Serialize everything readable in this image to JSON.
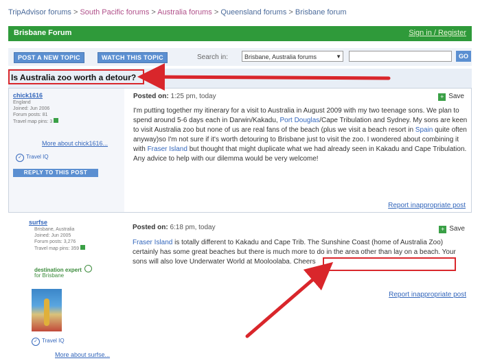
{
  "breadcrumb": [
    {
      "label": "TripAdvisor forums",
      "style": "blue"
    },
    {
      "label": "South Pacific forums",
      "style": "pink"
    },
    {
      "label": "Australia forums",
      "style": "pink"
    },
    {
      "label": "Queensland forums",
      "style": "blue"
    },
    {
      "label": "Brisbane forum",
      "style": "blue"
    }
  ],
  "breadcrumb_sep": ">",
  "forum_header": {
    "title": "Brisbane Forum",
    "signin": "Sign in / Register"
  },
  "toolbar": {
    "post_new": "POST A NEW TOPIC",
    "watch": "WATCH THIS TOPIC",
    "search_label": "Search in:",
    "search_scope": "Brisbane, Australia forums",
    "go": "GO"
  },
  "topic": {
    "title": "Is Australia zoo worth a detour?"
  },
  "posts": [
    {
      "username": "chick1616",
      "meta": [
        "England",
        "Joined: Jun 2006",
        "Forum posts: 81",
        "Travel map pins: 3"
      ],
      "more_about": "More about chick1616...",
      "travel_iq": "Travel IQ",
      "reply": "REPLY TO THIS POST",
      "posted_label": "Posted on:",
      "posted_time": "1:25 pm, today",
      "save": "Save",
      "body_parts": {
        "p1": "I'm putting together my itinerary for a visit to Australia in August 2009 with my two teenage sons. We plan to spend around 5-6 days each in Darwin/Kakadu, ",
        "l1": "Port Douglas",
        "p2": "/Cape Tribulation and Sydney. My sons are keen to visit Australia zoo but none of us are real fans of the beach (plus we visit a beach resort in ",
        "l2": "Spain",
        "p3": " quite often anyway)so I'm not sure if it's worth detouring to Brisbane just to visit the zoo. I wondered about combining it with ",
        "l3": "Fraser Island",
        "p4": " but thought that might duplicate what we had already seen in Kakadu and Cape Tribulation. Any advice to help with our dilemma would be very welcome!"
      },
      "report": "Report inappropriate post"
    },
    {
      "username": "surfse",
      "meta": [
        "Brisbane, Australia",
        "Joined: Jun 2005",
        "Forum posts: 3,276",
        "Travel map pins: 359"
      ],
      "destination_expert": "destination expert",
      "expert_for": "for Brisbane",
      "travel_iq": "Travel IQ",
      "more_about": "More about surfse...",
      "posted_label": "Posted on:",
      "posted_time": "6:18 pm, today",
      "save": "Save",
      "body_parts": {
        "l1": "Fraser Island",
        "p1": " is totally different to Kakadu and Cape Trib. The Sunshine Coast (home of Australia Zoo) certainly has some great beaches but there is much more to do in the area other than lay on a beach. Your sons will also love ",
        "p2": "Underwater World at Mooloolaba",
        "p3": ". Cheers"
      },
      "report": "Report inappropriate post"
    }
  ],
  "colors": {
    "accent_green": "#2f9a3a",
    "annotation_red": "#d9262b",
    "link_blue": "#3366bb"
  }
}
